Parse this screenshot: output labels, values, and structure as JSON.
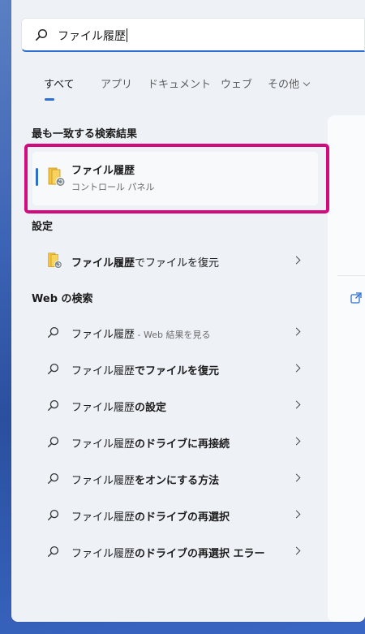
{
  "search": {
    "query": "ファイル履歴"
  },
  "tabs": [
    {
      "label": "すべて"
    },
    {
      "label": "アプリ"
    },
    {
      "label": "ドキュメント"
    },
    {
      "label": "ウェブ"
    },
    {
      "label": "その他"
    }
  ],
  "best_match": {
    "heading": "最も一致する検索結果",
    "title": "ファイル履歴",
    "subtitle": "コントロール パネル"
  },
  "settings": {
    "heading": "設定",
    "item": {
      "bold": "ファイル履歴",
      "rest": "でファイルを復元"
    }
  },
  "web": {
    "heading": "Web の検索",
    "items": [
      {
        "bold": "ファイル履歴",
        "suffix": " - Web 結果を見る",
        "rest": ""
      },
      {
        "bold": "",
        "suffix": "",
        "rest": "ファイル履歴",
        "tail": "でファイルを復元"
      },
      {
        "bold": "",
        "suffix": "",
        "rest": "ファイル履歴",
        "tail": "の設定"
      },
      {
        "bold": "",
        "suffix": "",
        "rest": "ファイル履歴",
        "tail": "のドライブに再接続"
      },
      {
        "bold": "",
        "suffix": "",
        "rest": "ファイル履歴",
        "tail": "をオンにする方法"
      },
      {
        "bold": "",
        "suffix": "",
        "rest": "ファイル履歴",
        "tail": "のドライブの再選択"
      },
      {
        "bold": "",
        "suffix": "",
        "rest": "ファイル履歴",
        "tail": "のドライブの再選択 エラー"
      }
    ]
  },
  "colors": {
    "accent": "#2d6fd0",
    "highlight_border": "#d3097e"
  },
  "icons": {
    "search": "search-icon",
    "folder": "file-history-folder-icon",
    "chevron": "chevron-right-icon",
    "open": "open-external-icon"
  }
}
